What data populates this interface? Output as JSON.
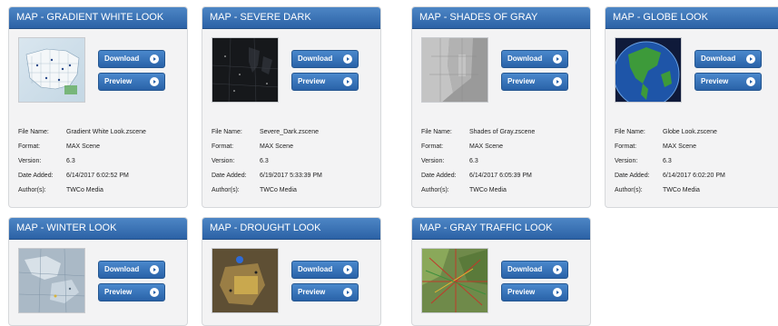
{
  "labels": {
    "download": "Download",
    "preview": "Preview",
    "file_name": "File Name:",
    "format": "Format:",
    "version": "Version:",
    "date_added": "Date Added:",
    "authors": "Author(s):"
  },
  "cards": [
    {
      "title": "MAP - GRADIENT WHITE LOOK",
      "thumbnail": "map-gradient-white-thumbnail",
      "file_name": "Gradient White Look.zscene",
      "format": "MAX Scene",
      "version": "6.3",
      "date_added": "6/14/2017 6:02:52 PM",
      "authors": "TWCo Media"
    },
    {
      "title": "MAP - SEVERE DARK",
      "thumbnail": "map-severe-dark-thumbnail",
      "file_name": "Severe_Dark.zscene",
      "format": "MAX Scene",
      "version": "6.3",
      "date_added": "6/19/2017 5:33:39 PM",
      "authors": "TWCo Media"
    },
    {
      "title": "MAP - SHADES OF GRAY",
      "thumbnail": "map-shades-of-gray-thumbnail",
      "file_name": "Shades of Gray.zscene",
      "format": "MAX Scene",
      "version": "6.3",
      "date_added": "6/14/2017 6:05:39 PM",
      "authors": "TWCo Media"
    },
    {
      "title": "MAP - GLOBE LOOK",
      "thumbnail": "map-globe-thumbnail",
      "file_name": "Globe Look.zscene",
      "format": "MAX Scene",
      "version": "6.3",
      "date_added": "6/14/2017 6:02:20 PM",
      "authors": "TWCo Media"
    },
    {
      "title": "MAP - WINTER LOOK",
      "thumbnail": "map-winter-thumbnail"
    },
    {
      "title": "MAP - DROUGHT LOOK",
      "thumbnail": "map-drought-thumbnail"
    },
    {
      "title": "MAP - GRAY TRAFFIC LOOK",
      "thumbnail": "map-gray-traffic-thumbnail"
    }
  ]
}
